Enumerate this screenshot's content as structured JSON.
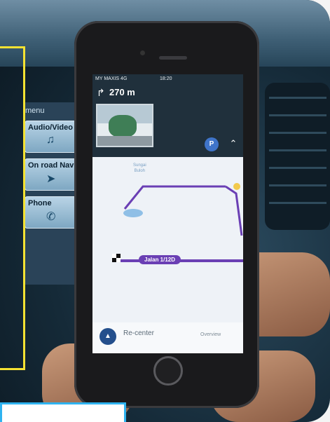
{
  "car_display": {
    "menu_title": "menu",
    "buttons": [
      {
        "label": "Audio/Video",
        "icon": "music-note-icon"
      },
      {
        "label": "On road Nav",
        "icon": "compass-icon"
      },
      {
        "label": "Phone",
        "icon": "phone-handset-icon"
      }
    ]
  },
  "phone_status": {
    "carrier": "MY MAXIS 4G",
    "time": "18:20"
  },
  "navigation": {
    "distance": "270 m",
    "turn_icon": "turn-right-arrow-icon",
    "parking_label": "P",
    "road_label_top": "Sungai\nBuloh",
    "road_label_main": "Jalan 1/12D",
    "recenter_label": "Re-center",
    "overview_label": "Overview",
    "route_color": "#6a3fb4"
  },
  "colors": {
    "frame_yellow": "#f5e232",
    "frame_blue": "#2fb3f0"
  }
}
